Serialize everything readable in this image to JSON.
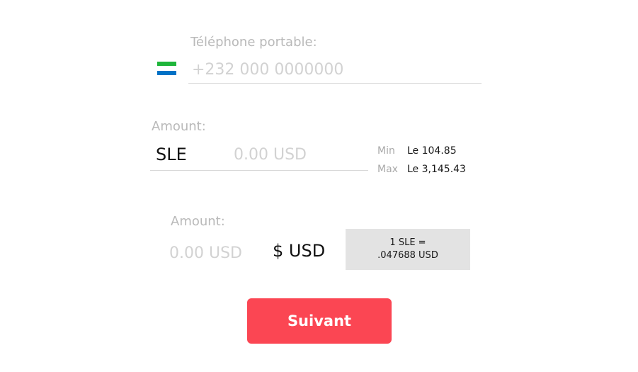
{
  "phone": {
    "label": "Téléphone portable:",
    "placeholder": "+232 000 0000000",
    "flag": {
      "icon": "sierra-leone-flag-icon",
      "colors": [
        "#1eb53a",
        "#ffffff",
        "#0072c6"
      ]
    }
  },
  "send_amount": {
    "label": "Amount:",
    "currency": "SLE",
    "placeholder": "0.00 USD",
    "min_label": "Min",
    "min_value": "Le 104.85",
    "max_label": "Max",
    "max_value": "Le 3,145.43"
  },
  "receive_amount": {
    "label": "Amount:",
    "placeholder": "0.00 USD",
    "currency": "$ USD"
  },
  "rate": {
    "line1": "1 SLE =",
    "line2": ".047688 USD"
  },
  "submit": {
    "label": "Suivant",
    "color": "#fb4653"
  }
}
